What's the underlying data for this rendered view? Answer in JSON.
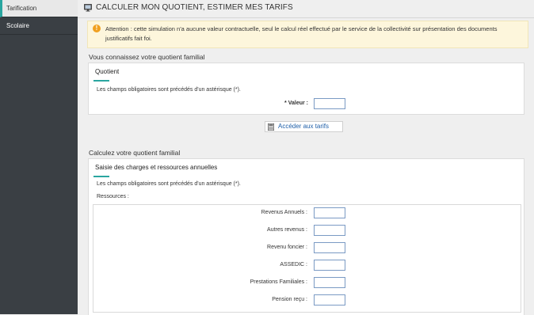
{
  "sidebar": {
    "items": [
      {
        "label": "Tarification",
        "active": true
      },
      {
        "label": "Scolaire",
        "active": false
      }
    ]
  },
  "header": {
    "title": "CALCULER MON QUOTIENT, ESTIMER MES TARIFS",
    "icon": "monitor-icon"
  },
  "alert": {
    "icon": "warning-icon",
    "text": "Attention : cette simulation n'a aucune valeur contractuelle, seul le calcul réel effectué par le service de la collectivité sur présentation des documents justificatifs fait foi."
  },
  "known": {
    "heading": "Vous connaissez votre quotient familial",
    "panel_title": "Quotient",
    "required_note": "Les champs obligatoires sont précédés d'un astérisque (*).",
    "value_label": "* Valeur :",
    "value": ""
  },
  "tarifs_button": {
    "label": "Accéder aux tarifs",
    "icon": "calculator-icon"
  },
  "calc": {
    "heading": "Calculez votre quotient familial",
    "panel_title": "Saisie des charges et ressources annuelles",
    "required_note": "Les champs obligatoires sont précédés d'un astérisque (*).",
    "resources_label": "Ressources :",
    "fields": [
      {
        "label": "Revenus Annuels :",
        "value": ""
      },
      {
        "label": "Autres revenus :",
        "value": ""
      },
      {
        "label": "Revenu foncier :",
        "value": ""
      },
      {
        "label": "ASSEDIC :",
        "value": ""
      },
      {
        "label": "Prestations Familiales :",
        "value": ""
      },
      {
        "label": "Pension reçu :",
        "value": ""
      }
    ]
  },
  "colors": {
    "sidebar_bg": "#3a3f44",
    "accent": "#2aa6a0",
    "alert_bg": "#fdf6dc",
    "warning": "#f0a020",
    "link": "#1f5fa8"
  }
}
